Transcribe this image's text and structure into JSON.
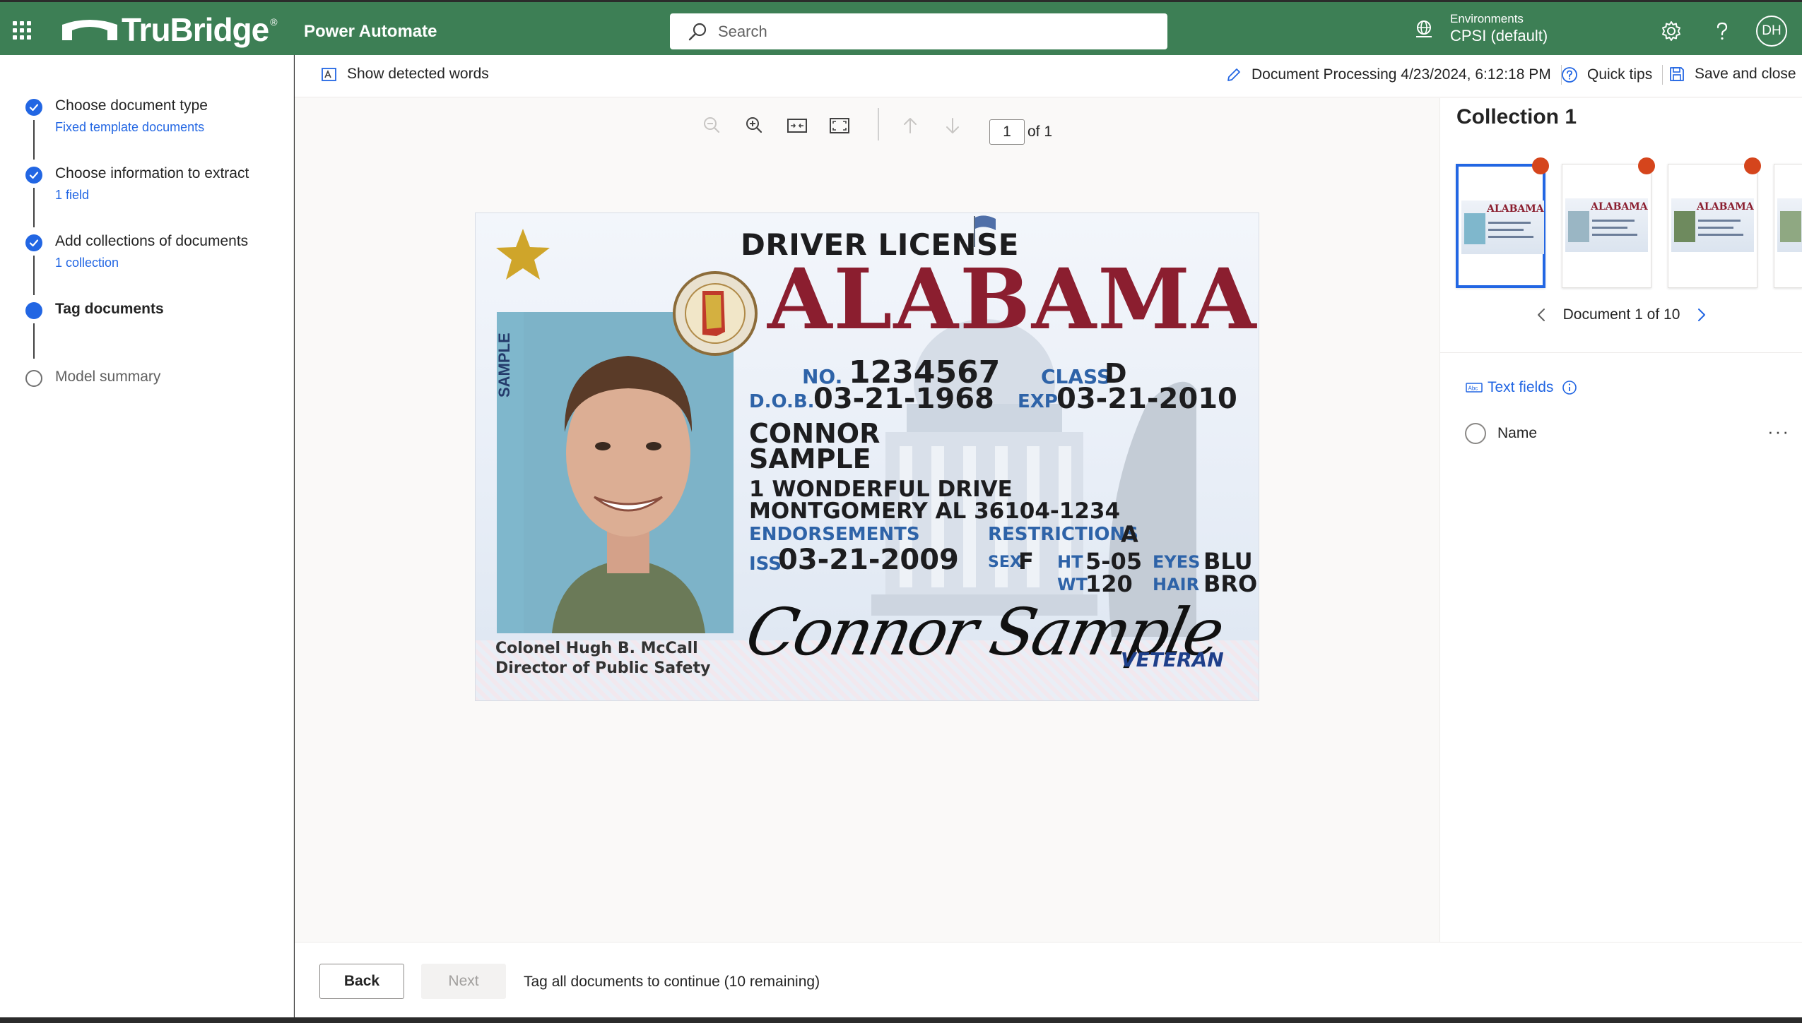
{
  "header": {
    "brand": "TruBridge",
    "brand_mark": "®",
    "app_name": "Power Automate",
    "search_placeholder": "Search",
    "env_label": "Environments",
    "env_value": "CPSI (default)",
    "avatar_initials": "DH",
    "brand_color": "#3d7f55"
  },
  "steps": [
    {
      "title": "Choose document type",
      "subtitle": "Fixed template documents",
      "state": "done"
    },
    {
      "title": "Choose information to extract",
      "subtitle": "1 field",
      "state": "done"
    },
    {
      "title": "Add collections of documents",
      "subtitle": "1 collection",
      "state": "done"
    },
    {
      "title": "Tag documents",
      "subtitle": "",
      "state": "current"
    },
    {
      "title": "Model summary",
      "subtitle": "",
      "state": "todo"
    }
  ],
  "commandbar": {
    "show_words": "Show detected words",
    "doc_title": "Document Processing 4/23/2024, 6:12:18 PM",
    "quick_tips": "Quick tips",
    "save_close": "Save and close"
  },
  "viewer": {
    "page_current": "1",
    "page_total": "of 1",
    "tool_icons": [
      "zoom-out-icon",
      "zoom-in-icon",
      "fit-width-icon",
      "fit-page-icon",
      "arrow-up-icon",
      "arrow-down-icon"
    ]
  },
  "license": {
    "title": "DRIVER LICENSE",
    "state": "ALABAMA",
    "sample_vertical": "SAMPLE",
    "no_label": "NO.",
    "no_value": "1234567",
    "class_label": "CLASS",
    "class_value": "D",
    "dob_label": "D.O.B.",
    "dob_value": "03-21-1968",
    "exp_label": "EXP",
    "exp_value": "03-21-2010",
    "name_line1": "CONNOR",
    "name_line2": "SAMPLE",
    "address_line1": "1 WONDERFUL DRIVE",
    "address_line2": "MONTGOMERY AL 36104-1234",
    "endorsements_label": "ENDORSEMENTS",
    "restrictions_label": "RESTRICTIONS",
    "restrictions_value": "A",
    "iss_label": "ISS",
    "iss_value": "03-21-2009",
    "sex_label": "SEX",
    "sex_value": "F",
    "ht_label": "HT",
    "ht_value": "5-05",
    "wt_label": "WT",
    "wt_value": "120",
    "eyes_label": "EYES",
    "eyes_value": "BLU",
    "hair_label": "HAIR",
    "hair_value": "BRO",
    "signature": "Connor Sample",
    "official_name": "Colonel Hugh B. McCall",
    "official_title": "Director of Public Safety",
    "veteran": "VETERAN"
  },
  "collection": {
    "title": "Collection 1",
    "doc_nav": "Document 1 of 10",
    "thumbnail_count_visible": 4,
    "text_fields_label": "Text fields",
    "fields": [
      {
        "name": "Name"
      }
    ],
    "more_label": "···"
  },
  "footer": {
    "back": "Back",
    "next": "Next",
    "message": "Tag all documents to continue (10 remaining)"
  }
}
